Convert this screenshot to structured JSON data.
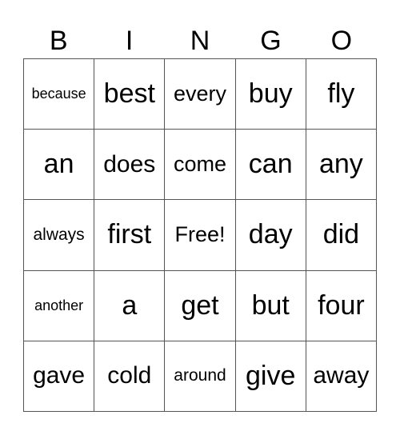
{
  "header": [
    "B",
    "I",
    "N",
    "G",
    "O"
  ],
  "cells": [
    [
      "because",
      "best",
      "every",
      "buy",
      "fly"
    ],
    [
      "an",
      "does",
      "come",
      "can",
      "any"
    ],
    [
      "always",
      "first",
      "Free!",
      "day",
      "did"
    ],
    [
      "another",
      "a",
      "get",
      "but",
      "four"
    ],
    [
      "gave",
      "cold",
      "around",
      "give",
      "away"
    ]
  ]
}
